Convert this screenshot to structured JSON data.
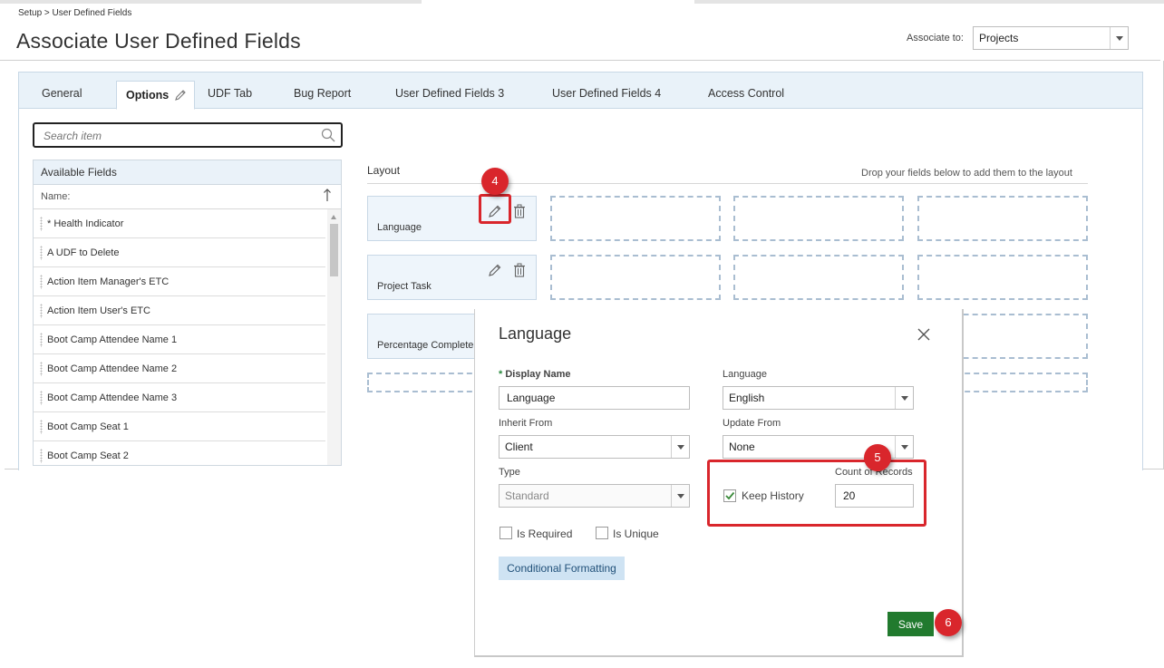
{
  "header": {
    "breadcrumb": "Setup > User Defined Fields",
    "title": "Associate User Defined Fields",
    "associate_label": "Associate to:",
    "associate_value": "Projects"
  },
  "tabs": [
    {
      "label": "General"
    },
    {
      "label": "Options",
      "active": true
    },
    {
      "label": "UDF Tab"
    },
    {
      "label": "Bug Report"
    },
    {
      "label": "User Defined Fields 3"
    },
    {
      "label": "User Defined Fields 4"
    },
    {
      "label": "Access Control"
    }
  ],
  "search": {
    "placeholder": "Search item"
  },
  "available_fields": {
    "title": "Available Fields",
    "column": "Name:",
    "items": [
      "* Health Indicator",
      "A UDF to Delete",
      "Action Item Manager's ETC",
      "Action Item User's ETC",
      "Boot Camp Attendee Name 1",
      "Boot Camp Attendee Name 2",
      "Boot Camp Attendee Name 3",
      "Boot Camp Seat 1",
      "Boot Camp Seat 2"
    ]
  },
  "layout": {
    "label": "Layout",
    "hint": "Drop your fields below to add them to the layout",
    "fields": [
      "Language",
      "Project Task",
      "Percentage Complete"
    ]
  },
  "modal": {
    "title": "Language",
    "display_name_label": "Display Name",
    "display_name_value": "Language",
    "language_label": "Language",
    "language_value": "English",
    "inherit_from_label": "Inherit From",
    "inherit_from_value": "Client",
    "update_from_label": "Update From",
    "update_from_value": "None",
    "type_label": "Type",
    "type_value": "Standard",
    "keep_history_label": "Keep History",
    "keep_history_checked": true,
    "count_label": "Count of Records",
    "count_value": "20",
    "is_required_label": "Is Required",
    "is_unique_label": "Is Unique",
    "conditional_formatting_label": "Conditional Formatting",
    "save_label": "Save"
  },
  "callouts": [
    "4",
    "5",
    "6"
  ],
  "colors": {
    "accent_red": "#d9262c",
    "save_green": "#217a2e",
    "tab_bar": "#e9f2f9",
    "field_box": "#eef5fb"
  }
}
